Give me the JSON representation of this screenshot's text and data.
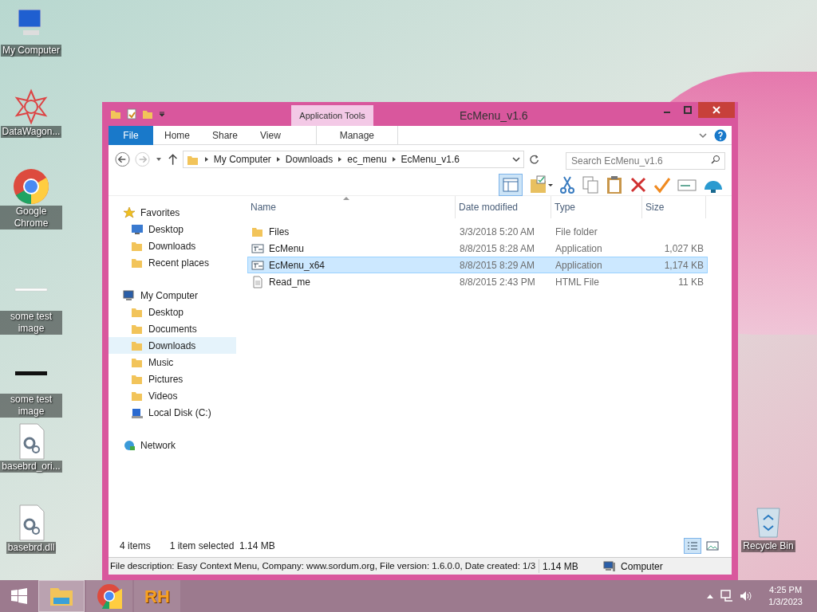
{
  "desktop_icons": [
    {
      "label": "My Computer",
      "kind": "computer"
    },
    {
      "label": "DataWagon...",
      "kind": "star"
    },
    {
      "label": "Google Chrome",
      "kind": "chrome"
    },
    {
      "label": "some test image",
      "kind": "image"
    },
    {
      "label": "some test image",
      "kind": "image-dark"
    },
    {
      "label": "basebrd_ori...",
      "kind": "gear-file"
    },
    {
      "label": "basebrd.dll",
      "kind": "gear-file"
    },
    {
      "label": "Recycle Bin",
      "kind": "bin"
    }
  ],
  "window": {
    "title": "EcMenu_v1.6",
    "context_tab": "Application Tools"
  },
  "ribbon_tabs": [
    {
      "label": "File",
      "kind": "file"
    },
    {
      "label": "Home",
      "kind": "tab"
    },
    {
      "label": "Share",
      "kind": "tab"
    },
    {
      "label": "View",
      "kind": "tab"
    },
    {
      "label": "Manage",
      "kind": "context"
    }
  ],
  "address": {
    "crumbs": [
      "My Computer",
      "Downloads",
      "ec_menu",
      "EcMenu_v1.6"
    ],
    "search_placeholder": "Search EcMenu_v1.6"
  },
  "nav": [
    {
      "label": "Favorites",
      "kind": "star",
      "selected": false,
      "children": [
        {
          "label": "Desktop",
          "kind": "desktop",
          "selected": false
        },
        {
          "label": "Downloads",
          "kind": "folder",
          "selected": false
        },
        {
          "label": "Recent places",
          "kind": "folder",
          "selected": false
        }
      ]
    },
    {
      "label": "My Computer",
      "kind": "computer",
      "selected": false,
      "children": [
        {
          "label": "Desktop",
          "kind": "folder",
          "selected": false
        },
        {
          "label": "Documents",
          "kind": "folder",
          "selected": false
        },
        {
          "label": "Downloads",
          "kind": "folder",
          "selected": true
        },
        {
          "label": "Music",
          "kind": "folder",
          "selected": false
        },
        {
          "label": "Pictures",
          "kind": "folder",
          "selected": false
        },
        {
          "label": "Videos",
          "kind": "folder",
          "selected": false
        },
        {
          "label": "Local Disk (C:)",
          "kind": "disk",
          "selected": false
        }
      ]
    },
    {
      "label": "Network",
      "kind": "network",
      "selected": false
    }
  ],
  "columns": [
    "Name",
    "Date modified",
    "Type",
    "Size"
  ],
  "files": [
    {
      "name": "Files",
      "date": "3/3/2018 5:20 AM",
      "type": "File folder",
      "kind": "folder",
      "selected": false
    },
    {
      "name": "EcMenu",
      "date": "8/8/2015 8:28 AM",
      "type": "Application",
      "size": "1,027 KB",
      "kind": "app",
      "selected": false
    },
    {
      "name": "EcMenu_x64",
      "date": "8/8/2015 8:29 AM",
      "type": "Application",
      "size": "1,174 KB",
      "kind": "app",
      "selected": true
    },
    {
      "name": "Read_me",
      "date": "8/8/2015 2:43 PM",
      "type": "HTML File",
      "size": "11 KB",
      "kind": "doc",
      "selected": false
    }
  ],
  "item_count": "4 items",
  "selection_info": "1 item selected  1.14 MB",
  "status_bar": {
    "description": "File description: Easy Context Menu, Company: www.sordum.org, File version: 1.6.0.0, Date created: 1/3",
    "size": "1.14 MB",
    "location": "Computer"
  },
  "taskbar": {
    "time": "4:25 PM",
    "date": "1/3/2023",
    "apps": [
      {
        "kind": "explorer",
        "selected": true
      },
      {
        "kind": "chrome",
        "selected": false
      },
      {
        "kind": "rh",
        "label": "RH",
        "selected": false
      }
    ]
  }
}
